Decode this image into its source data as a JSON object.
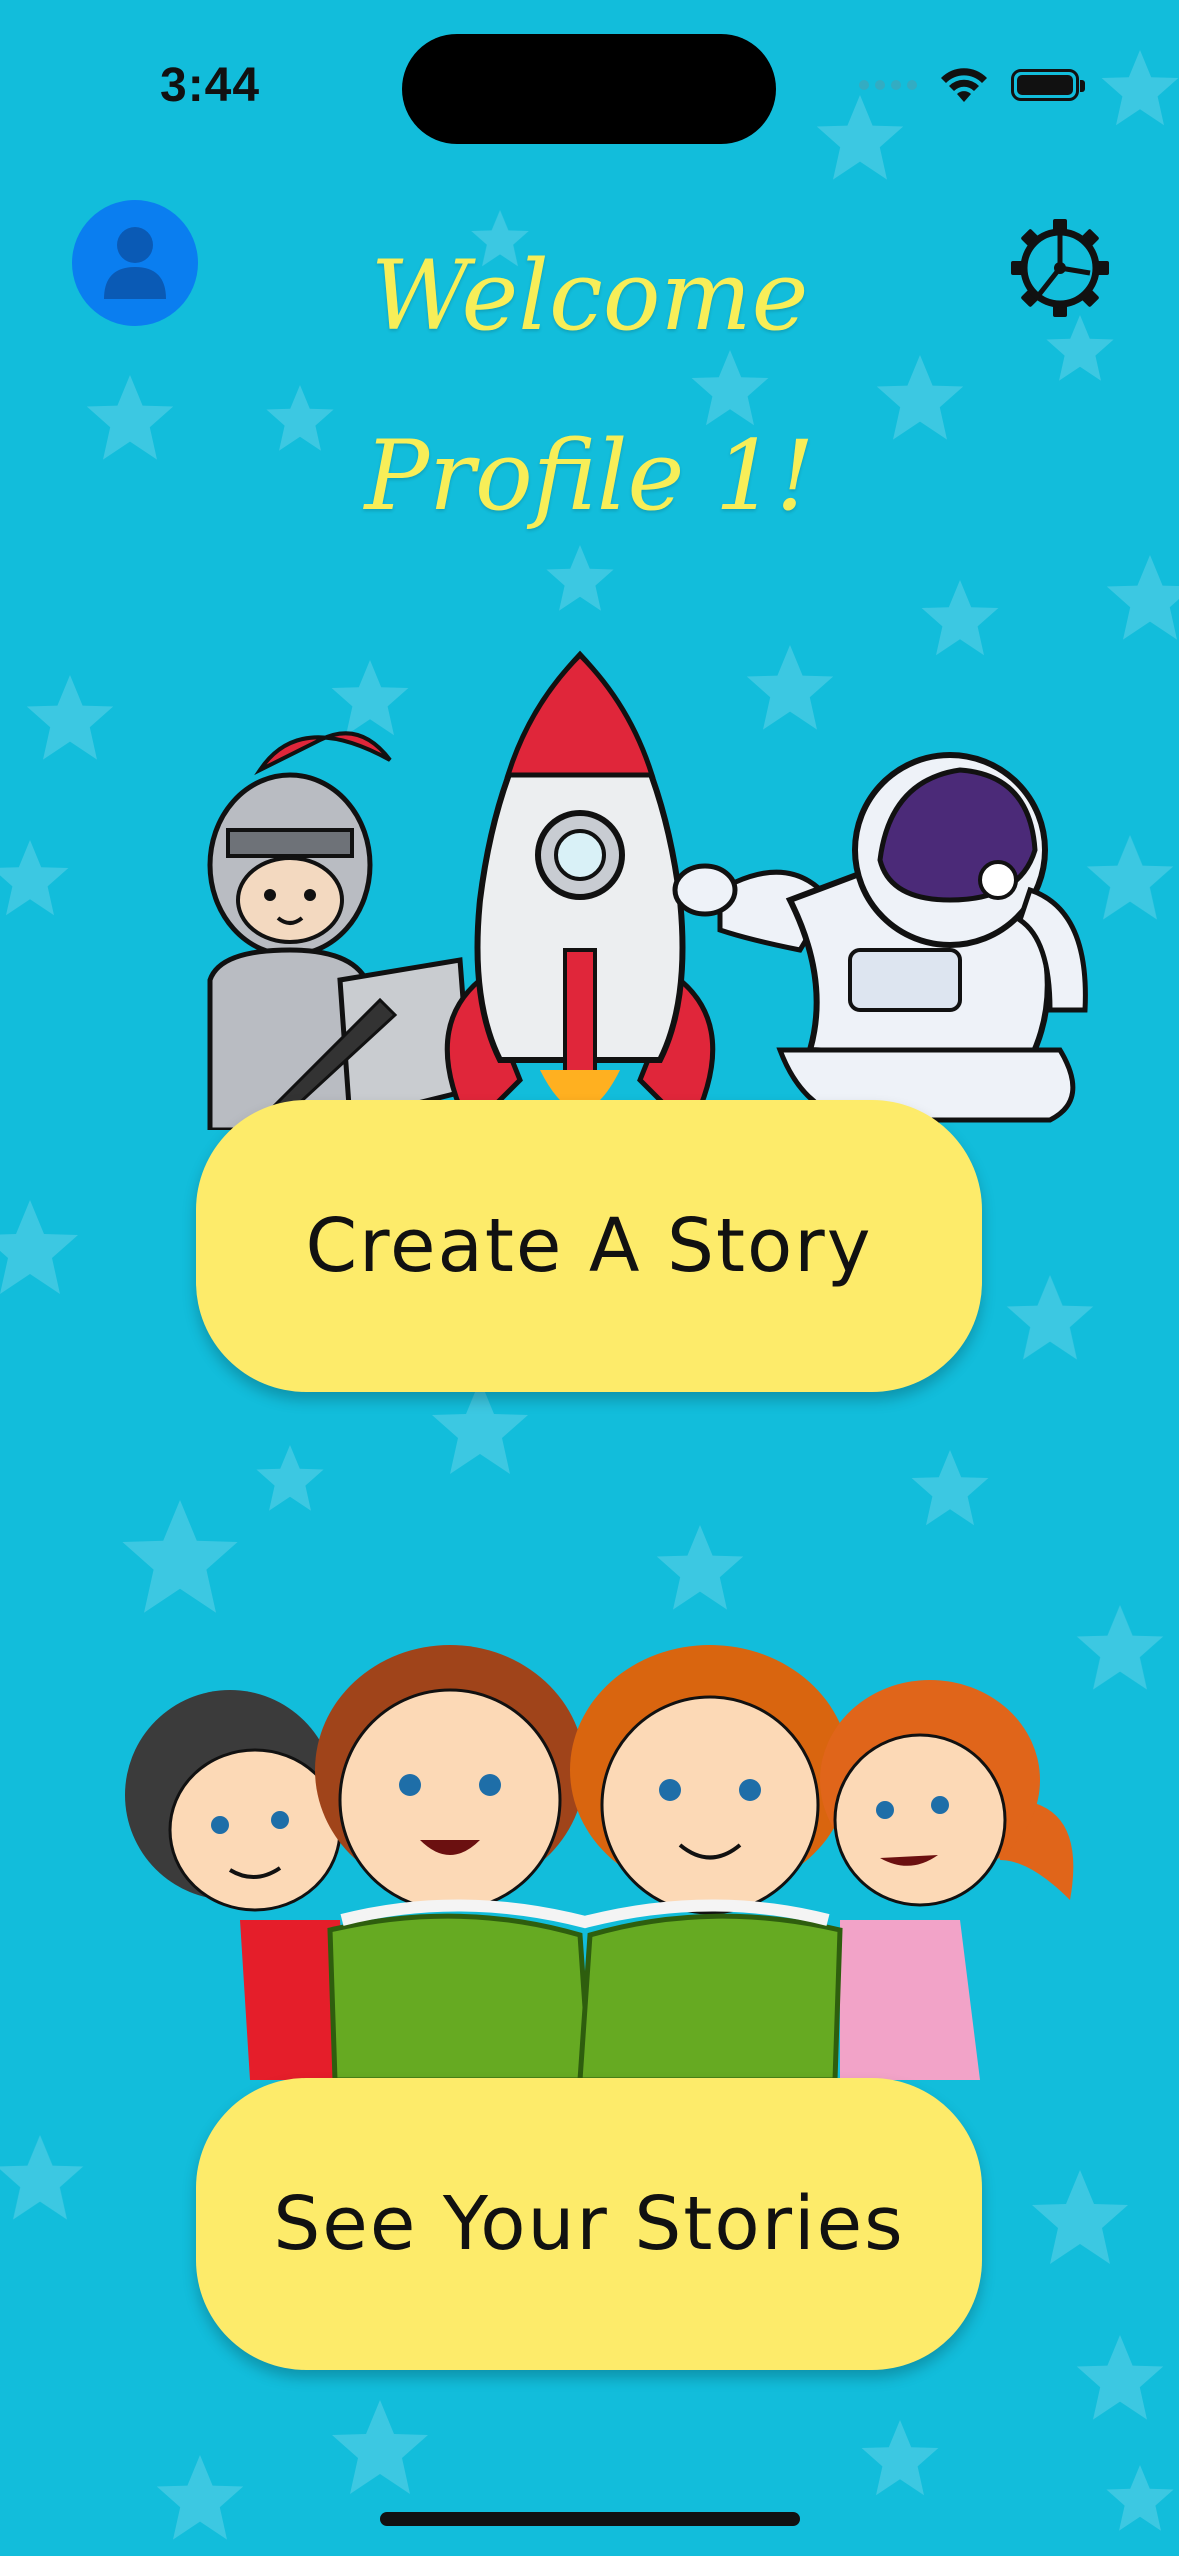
{
  "status_bar": {
    "time": "3:44",
    "icons": [
      "cellular-dots-icon",
      "wifi-icon",
      "battery-icon"
    ]
  },
  "header": {
    "profile_icon": "person-icon",
    "settings_icon": "gear-icon",
    "welcome_line1": "Welcome",
    "welcome_line2": "Profile 1!"
  },
  "buttons": {
    "create_story": "Create A Story",
    "see_stories": "See Your Stories"
  },
  "illustrations": {
    "top": "knight-rocket-astronaut",
    "bottom": "children-reading-book"
  },
  "colors": {
    "background": "#12bddb",
    "title_text": "#f7ee58",
    "button_fill": "#fdeb6a",
    "profile_button": "#0a7ef0"
  }
}
